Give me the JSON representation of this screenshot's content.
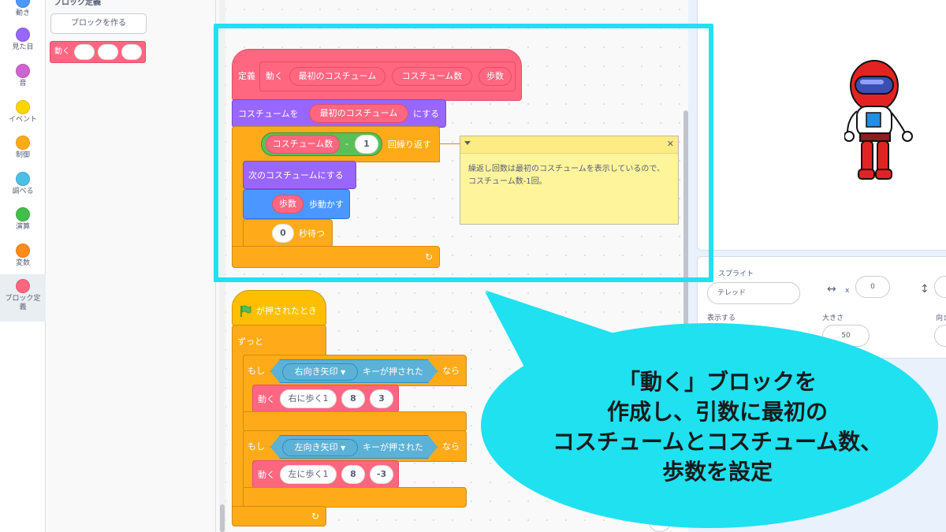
{
  "categories": [
    {
      "label": "動き",
      "color": "#4c97ff"
    },
    {
      "label": "見た目",
      "color": "#9966ff"
    },
    {
      "label": "音",
      "color": "#cf63cf"
    },
    {
      "label": "イベント",
      "color": "#ffd500"
    },
    {
      "label": "制御",
      "color": "#ffab19"
    },
    {
      "label": "調べる",
      "color": "#4cbfe6"
    },
    {
      "label": "演算",
      "color": "#40bf4a"
    },
    {
      "label": "変数",
      "color": "#ff8c1a"
    },
    {
      "label": "ブロック定義",
      "color": "#ff6680"
    }
  ],
  "palette": {
    "title": "ブロック定義",
    "make_block_button": "ブロックを作る",
    "custom_block_label": "動く"
  },
  "define_script": {
    "define_label": "定義",
    "block_name": "動く",
    "param1": "最初のコスチューム",
    "param2": "コスチューム数",
    "param3": "歩数",
    "switch_costume_label": "コスチュームを",
    "switch_costume_arg": "最初のコスチューム",
    "switch_costume_suffix": "にする",
    "repeat_arg": "コスチューム数",
    "minus_sign": "-",
    "minus_value": "1",
    "repeat_suffix": "回繰り返す",
    "next_costume": "次のコスチュームにする",
    "move_arg": "歩数",
    "move_suffix": "歩動かす",
    "wait_value": "0",
    "wait_suffix": "秒待つ",
    "loop_arrow": "↻"
  },
  "comment": {
    "text": "繰返し回数は最初のコスチュームを表示しているので、コスチューム数-1回。",
    "collapse_icon": "triangle-down-icon",
    "close_icon": "close-icon",
    "close_glyph": "✕"
  },
  "flag_script": {
    "hat_label": "が押されたとき",
    "forever_label": "ずっと",
    "if1_label": "もし",
    "if1_key": "右向き矢印",
    "if1_key_suffix": "キーが押された",
    "if1_then": "なら",
    "call1_label": "動く",
    "call1_arg1": "右に歩く1",
    "call1_arg2": "8",
    "call1_arg3": "3",
    "if2_label": "もし",
    "if2_key": "左向き矢印",
    "if2_key_suffix": "キーが押された",
    "if2_then": "なら",
    "call2_label": "動く",
    "call2_arg1": "左に歩く1",
    "call2_arg2": "8",
    "call2_arg3": "-3",
    "loop_arrow": "↻"
  },
  "sprite_info": {
    "sprite_label": "スプライト",
    "sprite_name": "テレッド",
    "x_label": "x",
    "x_value": "0",
    "y_label": "y",
    "show_label": "表示する",
    "size_label": "大きさ",
    "size_value": "50",
    "direction_label": "向き"
  },
  "callout": {
    "line1": "「動く」ブロックを",
    "line2": "作成し、引数に最初の",
    "line3": "コスチュームとコスチューム数、",
    "line4": "歩数を設定"
  },
  "colors": {
    "highlight": "#1fe1f0",
    "callout_fill": "#1fe1f0",
    "custom_block": "#ff6680",
    "looks": "#9966ff",
    "control": "#ffab19",
    "motion": "#4c97ff"
  }
}
